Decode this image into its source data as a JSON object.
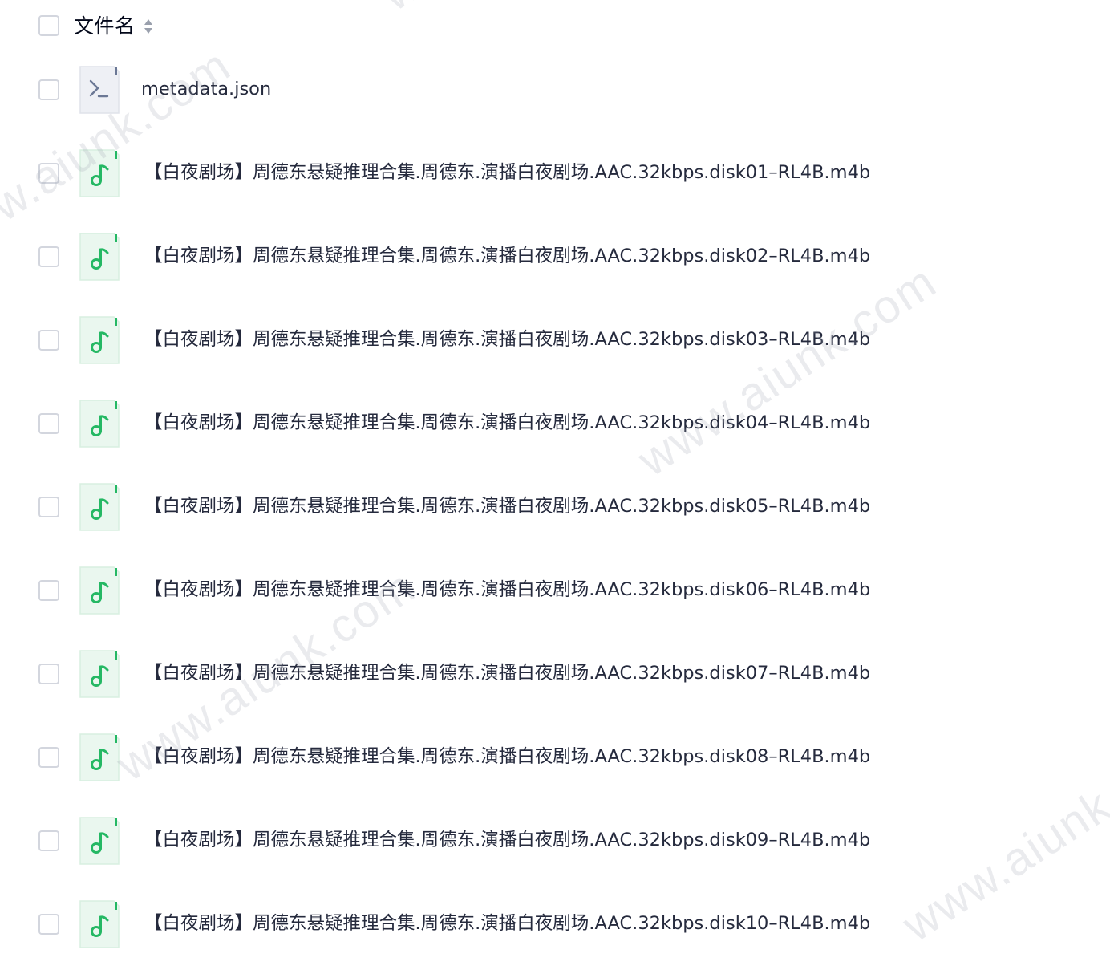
{
  "header": {
    "column_label": "文件名",
    "sort_icon": "sort-icon"
  },
  "files": [
    {
      "name": "metadata.json",
      "type": "json",
      "icon": "terminal-file-icon"
    },
    {
      "name": "【白夜剧场】周德东悬疑推理合集.周德东.演播白夜剧场.AAC.32kbps.disk01–RL4B.m4b",
      "type": "audio",
      "icon": "music-file-icon"
    },
    {
      "name": "【白夜剧场】周德东悬疑推理合集.周德东.演播白夜剧场.AAC.32kbps.disk02–RL4B.m4b",
      "type": "audio",
      "icon": "music-file-icon"
    },
    {
      "name": "【白夜剧场】周德东悬疑推理合集.周德东.演播白夜剧场.AAC.32kbps.disk03–RL4B.m4b",
      "type": "audio",
      "icon": "music-file-icon"
    },
    {
      "name": "【白夜剧场】周德东悬疑推理合集.周德东.演播白夜剧场.AAC.32kbps.disk04–RL4B.m4b",
      "type": "audio",
      "icon": "music-file-icon"
    },
    {
      "name": "【白夜剧场】周德东悬疑推理合集.周德东.演播白夜剧场.AAC.32kbps.disk05–RL4B.m4b",
      "type": "audio",
      "icon": "music-file-icon"
    },
    {
      "name": "【白夜剧场】周德东悬疑推理合集.周德东.演播白夜剧场.AAC.32kbps.disk06–RL4B.m4b",
      "type": "audio",
      "icon": "music-file-icon"
    },
    {
      "name": "【白夜剧场】周德东悬疑推理合集.周德东.演播白夜剧场.AAC.32kbps.disk07–RL4B.m4b",
      "type": "audio",
      "icon": "music-file-icon"
    },
    {
      "name": "【白夜剧场】周德东悬疑推理合集.周德东.演播白夜剧场.AAC.32kbps.disk08–RL4B.m4b",
      "type": "audio",
      "icon": "music-file-icon"
    },
    {
      "name": "【白夜剧场】周德东悬疑推理合集.周德东.演播白夜剧场.AAC.32kbps.disk09–RL4B.m4b",
      "type": "audio",
      "icon": "music-file-icon"
    },
    {
      "name": "【白夜剧场】周德东悬疑推理合集.周德东.演播白夜剧场.AAC.32kbps.disk10–RL4B.m4b",
      "type": "audio",
      "icon": "music-file-icon"
    }
  ],
  "watermark": {
    "text": "www.aiunk.com"
  },
  "colors": {
    "checkbox_border": "#d3d6de",
    "audio_icon_bg": "#eaf7ef",
    "audio_icon_accent": "#25b864",
    "json_icon_bg": "#eef0f5",
    "json_icon_accent": "#6b7895",
    "text": "#252a3d"
  }
}
